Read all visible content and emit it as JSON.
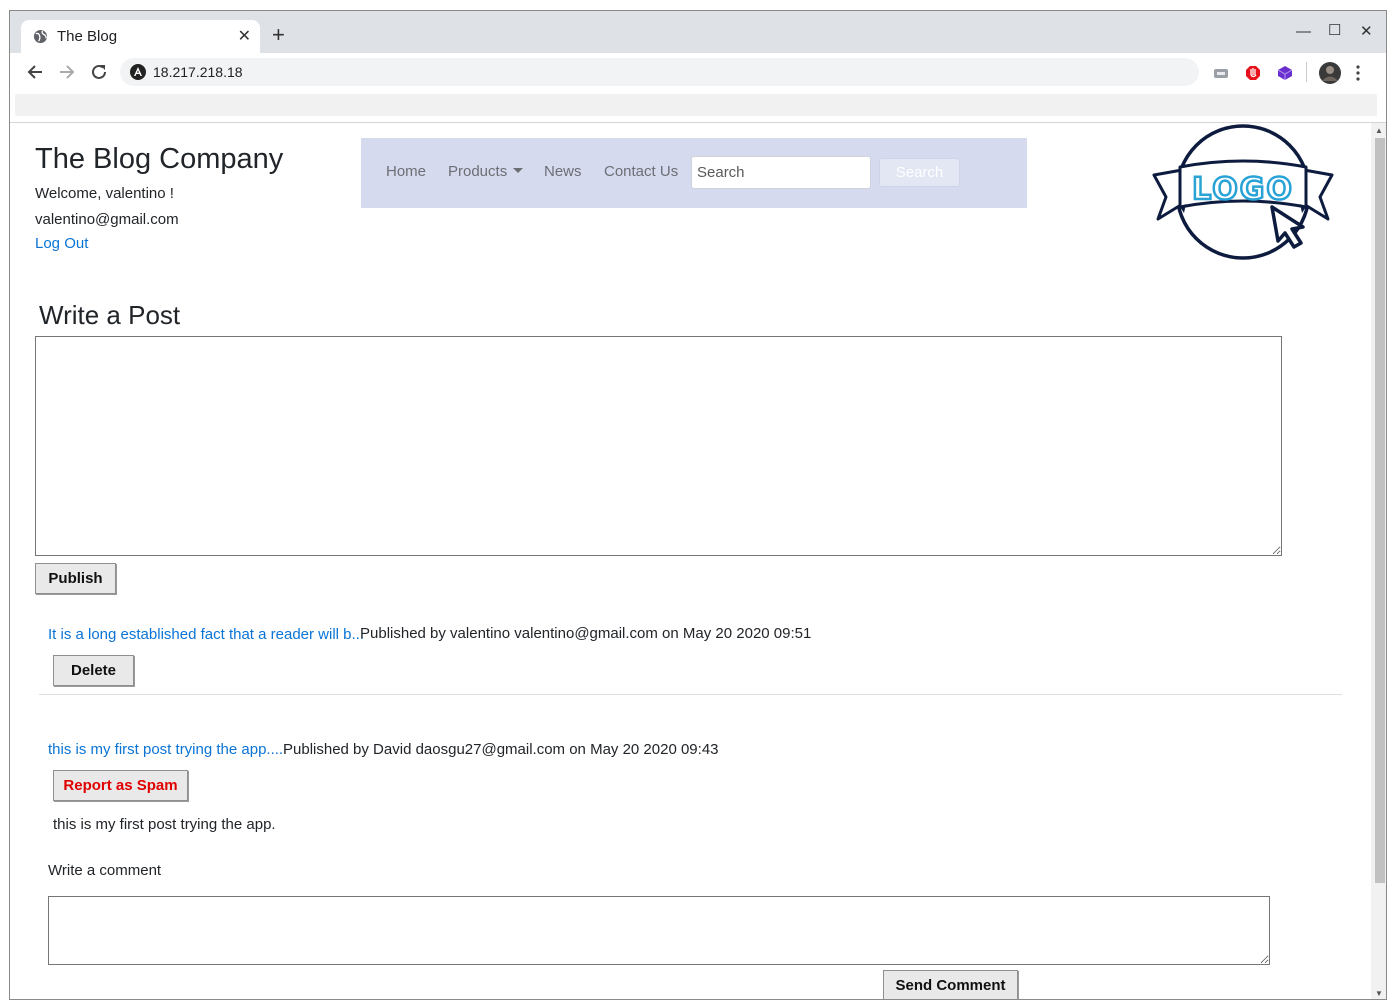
{
  "browser": {
    "tab_title": "The Blog",
    "tab_close": "✕",
    "new_tab": "+",
    "url": "18.217.218.18",
    "win_minimize": "—",
    "win_maximize": "☐",
    "win_close": "✕"
  },
  "site": {
    "title": "The Blog Company",
    "welcome": "Welcome, valentino !",
    "email": "valentino@gmail.com",
    "logout": "Log Out",
    "logo_text": "LOGO"
  },
  "nav": {
    "home": "Home",
    "products": "Products",
    "news": "News",
    "contact": "Contact Us",
    "search_placeholder": "Search",
    "search_button": "Search"
  },
  "write_post": {
    "title": "Write a Post",
    "publish_button": "Publish"
  },
  "posts": [
    {
      "link": "It is a long established fact that a reader will b...",
      "meta": "Published by valentino valentino@gmail.com on May 20 2020 09:51",
      "action_button": "Delete"
    },
    {
      "link": "this is my first post trying the app....",
      "meta": "Published by David daosgu27@gmail.com on May 20 2020 09:43",
      "action_button": "Report as Spam",
      "body": "this is my first post trying the app.",
      "comment_label": "Write a comment",
      "send_button": "Send Comment"
    }
  ],
  "colors": {
    "navbar_bg": "#d6daee",
    "link": "#0a74d6",
    "spam": "#e00000",
    "logo_navy": "#0d1b3e",
    "logo_blue": "#29a3d6"
  }
}
